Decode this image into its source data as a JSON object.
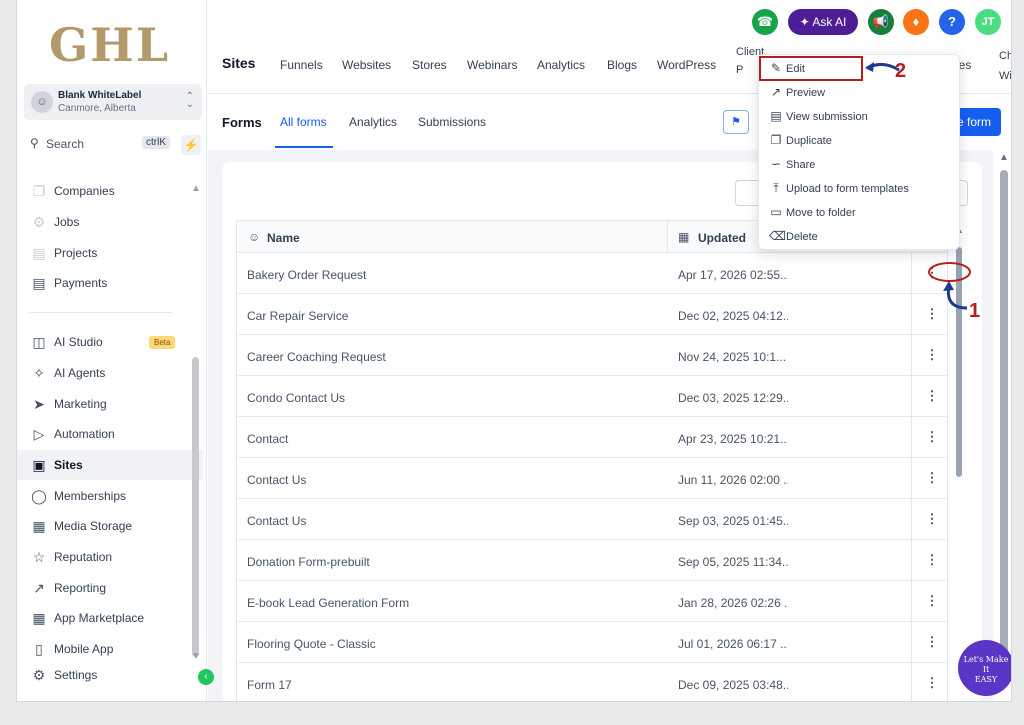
{
  "brand": {
    "logo": "GHL"
  },
  "account": {
    "name": "Blank WhiteLabel",
    "location": "Canmore, Alberta"
  },
  "search": {
    "label": "Search",
    "shortcut": "ctrlK"
  },
  "sidebar": {
    "items": [
      {
        "label": "Companies",
        "icon": "cube-icon"
      },
      {
        "label": "Jobs",
        "icon": "jobs-icon"
      },
      {
        "label": "Projects",
        "icon": "projects-icon"
      },
      {
        "label": "Payments",
        "icon": "payments-icon"
      },
      {
        "label": "AI Studio",
        "icon": "ai-studio-icon",
        "badge": "Beta"
      },
      {
        "label": "AI Agents",
        "icon": "sparkle-icon"
      },
      {
        "label": "Marketing",
        "icon": "send-icon"
      },
      {
        "label": "Automation",
        "icon": "automation-icon"
      },
      {
        "label": "Sites",
        "icon": "sites-icon",
        "active": true
      },
      {
        "label": "Memberships",
        "icon": "award-icon"
      },
      {
        "label": "Media Storage",
        "icon": "image-icon"
      },
      {
        "label": "Reputation",
        "icon": "star-icon"
      },
      {
        "label": "Reporting",
        "icon": "trend-icon"
      },
      {
        "label": "App Marketplace",
        "icon": "grid-icon"
      },
      {
        "label": "Mobile App",
        "icon": "mobile-icon"
      },
      {
        "label": "Settings",
        "icon": "gear-icon"
      }
    ]
  },
  "topbar": {
    "title": "Sites",
    "tabs": [
      "Funnels",
      "Websites",
      "Stores",
      "Webinars",
      "Analytics",
      "Blogs",
      "WordPress"
    ],
    "clipped_tab_top": "Client",
    "clipped_tab_bottom": "P",
    "clipped_right_1": "izzes",
    "clipped_right_2a": "Chat",
    "clipped_right_2b": "Widg",
    "ask_ai": "Ask AI",
    "avatar": "JT",
    "help": "?"
  },
  "subnav": {
    "title": "Forms",
    "tabs": [
      "All forms",
      "Analytics",
      "Submissions"
    ],
    "create_label": "ate form"
  },
  "table": {
    "headers": {
      "name": "Name",
      "updated": "Updated"
    },
    "rows": [
      {
        "name": "Bakery Order Request",
        "updated": "Apr 17, 2026 02:55..."
      },
      {
        "name": "Car Repair Service",
        "updated": "Dec 02, 2025 04:12..."
      },
      {
        "name": "Career Coaching Request",
        "updated": "Nov 24, 2025 10:1..."
      },
      {
        "name": "Condo Contact Us",
        "updated": "Dec 03, 2025 12:29..."
      },
      {
        "name": "Contact",
        "updated": "Apr 23, 2025 10:21..."
      },
      {
        "name": "Contact Us",
        "updated": "Jun 11, 2026 02:00 ..."
      },
      {
        "name": "Contact Us",
        "updated": "Sep 03, 2025 01:45..."
      },
      {
        "name": "Donation Form-prebuilt",
        "updated": "Sep 05, 2025 11:34..."
      },
      {
        "name": "E-book Lead Generation Form",
        "updated": "Jan 28, 2026 02:26 ..."
      },
      {
        "name": "Flooring Quote - Classic",
        "updated": "Jul 01, 2026 06:17 ..."
      },
      {
        "name": "Form 17",
        "updated": "Dec 09, 2025 03:48..."
      }
    ]
  },
  "menu": {
    "items": [
      {
        "label": "Edit",
        "icon": "pencil-icon"
      },
      {
        "label": "Preview",
        "icon": "external-link-icon"
      },
      {
        "label": "View submission",
        "icon": "document-icon"
      },
      {
        "label": "Duplicate",
        "icon": "copy-icon"
      },
      {
        "label": "Share",
        "icon": "share-icon"
      },
      {
        "label": "Upload to form templates",
        "icon": "upload-icon"
      },
      {
        "label": "Move to folder",
        "icon": "folder-icon"
      },
      {
        "label": "Delete",
        "icon": "trash-icon"
      }
    ]
  },
  "annotations": {
    "step1": "1",
    "step2": "2",
    "color": "#b91c1c"
  },
  "helper_badge": {
    "line1": "Let's Make",
    "line2": "It",
    "line3": "EASY"
  },
  "colors": {
    "accent": "#155eef",
    "askai": "#4c1d95",
    "logo": "#b39a6a"
  }
}
